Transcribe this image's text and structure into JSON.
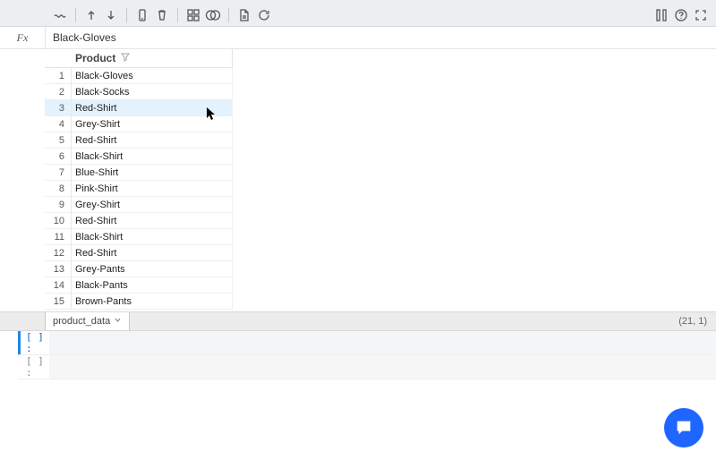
{
  "formula_bar": {
    "fx_label": "Fx",
    "value": "Black-Gloves"
  },
  "column": {
    "header": "Product"
  },
  "rows": [
    {
      "n": "1",
      "v": "Black-Gloves"
    },
    {
      "n": "2",
      "v": "Black-Socks"
    },
    {
      "n": "3",
      "v": "Red-Shirt"
    },
    {
      "n": "4",
      "v": "Grey-Shirt"
    },
    {
      "n": "5",
      "v": "Red-Shirt"
    },
    {
      "n": "6",
      "v": "Black-Shirt"
    },
    {
      "n": "7",
      "v": "Blue-Shirt"
    },
    {
      "n": "8",
      "v": "Pink-Shirt"
    },
    {
      "n": "9",
      "v": "Grey-Shirt"
    },
    {
      "n": "10",
      "v": "Red-Shirt"
    },
    {
      "n": "11",
      "v": "Black-Shirt"
    },
    {
      "n": "12",
      "v": "Red-Shirt"
    },
    {
      "n": "13",
      "v": "Grey-Pants"
    },
    {
      "n": "14",
      "v": "Black-Pants"
    },
    {
      "n": "15",
      "v": "Brown-Pants"
    }
  ],
  "selected_row_index": 2,
  "sheet_tab": {
    "name": "product_data"
  },
  "dimensions": "(21, 1)",
  "console": {
    "active_prompt": "[  ] :",
    "idle_prompt": "[  ] :"
  }
}
